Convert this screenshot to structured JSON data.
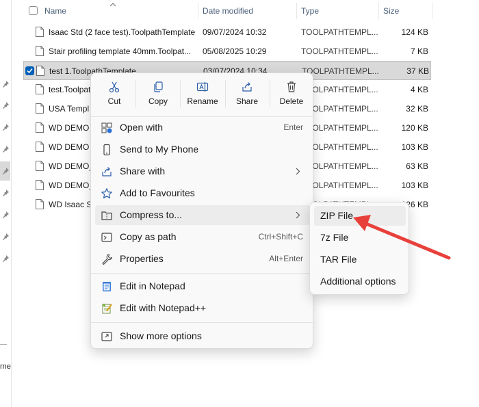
{
  "header": {
    "name": "Name",
    "date_modified": "Date modified",
    "type": "Type",
    "size": "Size"
  },
  "files": [
    {
      "name": "Isaac Std (2 face test).ToolpathTemplate",
      "date": "09/07/2024 10:32",
      "type": "TOOLPATHTEMPL...",
      "size": "124 KB"
    },
    {
      "name": "Stair profiling template 40mm.Toolpat...",
      "date": "05/08/2025 10:29",
      "type": "TOOLPATHTEMPL...",
      "size": "7 KB"
    },
    {
      "name": "test 1.ToolpathTemplate",
      "date": "03/07/2024 10:34",
      "type": "TOOLPATHTEMPL...",
      "size": "37 KB",
      "selected": true
    },
    {
      "name": "test.Toolpat",
      "date": "",
      "type": "TOOLPATHTEMPL...",
      "size": "4 KB"
    },
    {
      "name": "USA Templ",
      "date": "",
      "type": "TOOLPATHTEMPL...",
      "size": "32 KB"
    },
    {
      "name": "WD DEMO",
      "date": "",
      "type": "TOOLPATHTEMPL...",
      "size": "120 KB"
    },
    {
      "name": "WD DEMO",
      "date": "",
      "type": "TOOLPATHTEMPL...",
      "size": "103 KB"
    },
    {
      "name": "WD DEMO_",
      "date": "",
      "type": "TOOLPATHTEMPL...",
      "size": "63 KB"
    },
    {
      "name": "WD DEMO_",
      "date": "",
      "type": "TOOLPATHTEMPL...",
      "size": "103 KB"
    },
    {
      "name": "WD Isaac St",
      "date": "",
      "type": "TOOLPATHTEMPL...",
      "size": "126 KB"
    }
  ],
  "nav": {
    "partial_text": "rne"
  },
  "context_menu": {
    "quick_actions": [
      {
        "label": "Cut",
        "icon": "scissors-icon"
      },
      {
        "label": "Copy",
        "icon": "copy-icon"
      },
      {
        "label": "Rename",
        "icon": "rename-icon"
      },
      {
        "label": "Share",
        "icon": "share-icon"
      },
      {
        "label": "Delete",
        "icon": "trash-icon"
      }
    ],
    "items": [
      {
        "label": "Open with",
        "shortcut": "Enter",
        "icon": "open-with-icon"
      },
      {
        "label": "Send to My Phone",
        "shortcut": "",
        "icon": "phone-icon"
      },
      {
        "label": "Share with",
        "shortcut": "",
        "icon": "share-with-icon",
        "submenu": true
      },
      {
        "label": "Add to Favourites",
        "shortcut": "",
        "icon": "star-icon"
      },
      {
        "label": "Compress to...",
        "shortcut": "",
        "icon": "zip-folder-icon",
        "submenu": true,
        "active": true
      },
      {
        "label": "Copy as path",
        "shortcut": "Ctrl+Shift+C",
        "icon": "copy-path-icon"
      },
      {
        "label": "Properties",
        "shortcut": "Alt+Enter",
        "icon": "wrench-icon"
      },
      {
        "label": "Edit in Notepad",
        "shortcut": "",
        "icon": "notepad-icon"
      },
      {
        "label": "Edit with Notepad++",
        "shortcut": "",
        "icon": "notepadpp-icon"
      },
      {
        "label": "Show more options",
        "shortcut": "",
        "icon": "more-options-icon"
      }
    ]
  },
  "compress_submenu": {
    "items": [
      {
        "label": "ZIP File"
      },
      {
        "label": "7z File"
      },
      {
        "label": "TAR File"
      },
      {
        "label": "Additional options"
      }
    ]
  },
  "colors": {
    "accent": "#005fb8",
    "annotation_arrow": "#e8413b",
    "menu_bg": "#f9f9f9",
    "hover_bg": "#ececec"
  }
}
